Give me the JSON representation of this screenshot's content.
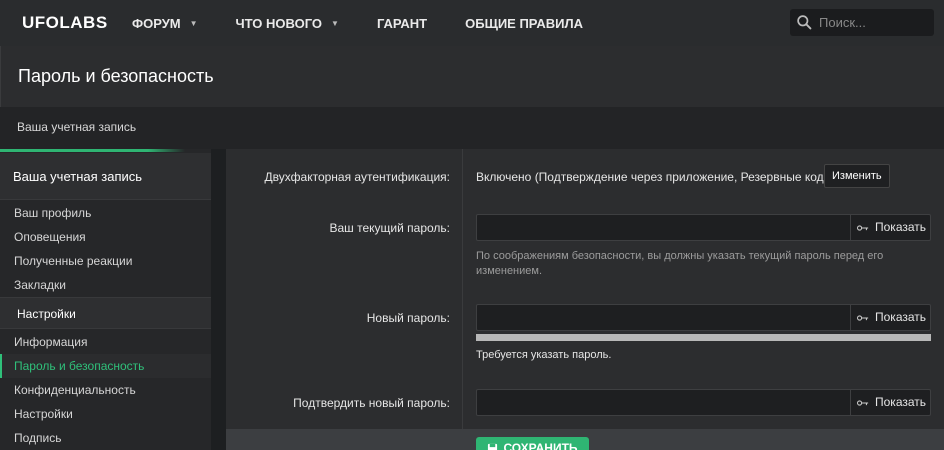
{
  "nav": {
    "logo": "UFOLABS",
    "items": [
      {
        "label": "ФОРУМ",
        "dropdown": true
      },
      {
        "label": "ЧТО НОВОГО",
        "dropdown": true
      },
      {
        "label": "ГАРАНТ",
        "dropdown": false
      },
      {
        "label": "ОБЩИЕ ПРАВИЛА",
        "dropdown": false
      }
    ],
    "search_placeholder": "Поиск..."
  },
  "page_title": "Пароль и безопасность",
  "breadcrumb": "Ваша учетная запись",
  "sidebar": {
    "header": "Ваша учетная запись",
    "account_links": [
      "Ваш профиль",
      "Оповещения",
      "Полученные реакции",
      "Закладки"
    ],
    "settings_header": "Настройки",
    "settings_links": [
      "Информация",
      "Пароль и безопасность",
      "Конфиденциальность",
      "Настройки",
      "Подпись"
    ],
    "active": "Пароль и безопасность"
  },
  "form": {
    "two_factor_label": "Двухфакторная аутентификация:",
    "two_factor_value": "Включено (Подтверждение через приложение, Резервные коды)",
    "change_button": "Изменить",
    "current_password_label": "Ваш текущий пароль:",
    "current_password_hint": "По соображениям безопасности, вы должны указать текущий пароль перед его изменением.",
    "new_password_label": "Новый пароль:",
    "new_password_required": "Требуется указать пароль.",
    "confirm_password_label": "Подтвердить новый пароль:",
    "show_label": "Показать",
    "save_button": "Сохранить"
  },
  "colors": {
    "accent": "#2fb573",
    "background": "#1d1f21"
  }
}
